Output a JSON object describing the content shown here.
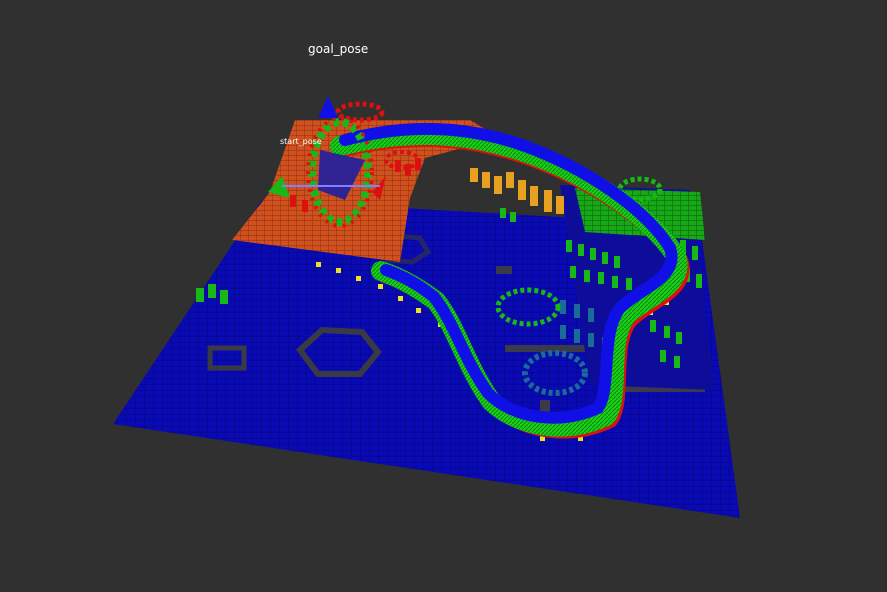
{
  "viewport": {
    "background_color": "#303030"
  },
  "labels": {
    "goal_pose": "goal_pose",
    "start_pose": "start_pose"
  },
  "colors": {
    "ground_map": "#0a0ab4",
    "elevated_map": "#d0501e",
    "obstacle_green": "#17b817",
    "path_blue": "#1010e6",
    "path_green": "#18d018",
    "path_red": "#dd1010",
    "marker_yellow": "#f0e020",
    "orange_cells": "#e8a020"
  },
  "icons": [
    "pose-arrow-marker-icon",
    "interactive-ring-marker-icon"
  ]
}
